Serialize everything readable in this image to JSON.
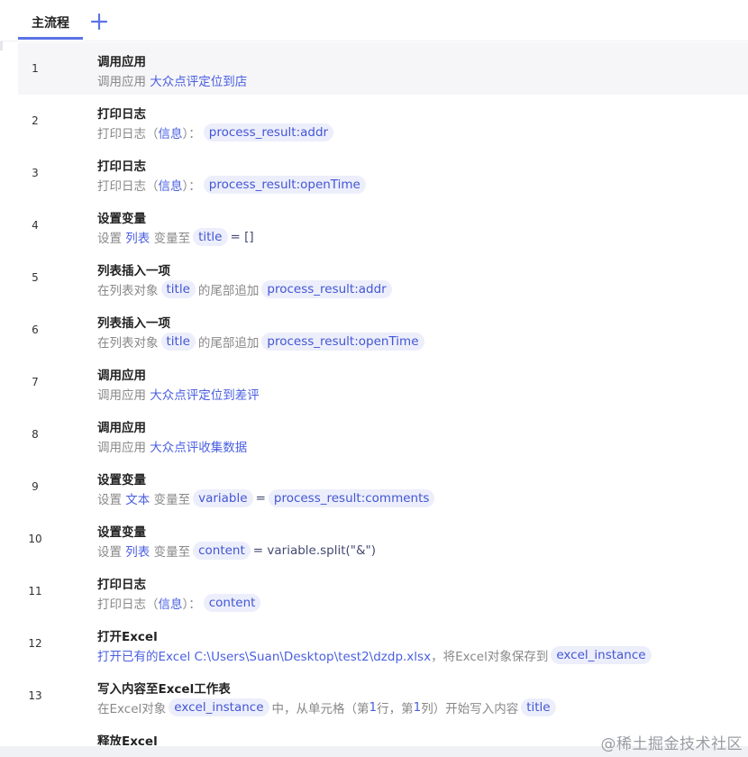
{
  "tabs": {
    "main_label": "主流程",
    "add_icon": "plus-icon"
  },
  "steps": [
    {
      "num": "1",
      "title": "调用应用",
      "selected": true,
      "segs": [
        {
          "t": "调用应用 ",
          "k": "t"
        },
        {
          "t": "大众点评定位到店",
          "k": "l"
        }
      ]
    },
    {
      "num": "2",
      "title": "打印日志",
      "segs": [
        {
          "t": "打印日志（",
          "k": "t"
        },
        {
          "t": "信息",
          "k": "l"
        },
        {
          "t": "）：",
          "k": "t"
        },
        {
          "t": "process_result:addr",
          "k": "p"
        }
      ]
    },
    {
      "num": "3",
      "title": "打印日志",
      "segs": [
        {
          "t": "打印日志（",
          "k": "t"
        },
        {
          "t": "信息",
          "k": "l"
        },
        {
          "t": "）：",
          "k": "t"
        },
        {
          "t": "process_result:openTime",
          "k": "p"
        }
      ]
    },
    {
      "num": "4",
      "title": "设置变量",
      "segs": [
        {
          "t": "设置 ",
          "k": "t"
        },
        {
          "t": "列表",
          "k": "l"
        },
        {
          "t": " 变量至",
          "k": "t"
        },
        {
          "t": "title",
          "k": "p"
        },
        {
          "t": "= []",
          "k": "c"
        }
      ]
    },
    {
      "num": "5",
      "title": "列表插入一项",
      "segs": [
        {
          "t": "在列表对象",
          "k": "t"
        },
        {
          "t": "title",
          "k": "p"
        },
        {
          "t": "的尾部追加",
          "k": "t"
        },
        {
          "t": "process_result:addr",
          "k": "p"
        }
      ]
    },
    {
      "num": "6",
      "title": "列表插入一项",
      "segs": [
        {
          "t": "在列表对象",
          "k": "t"
        },
        {
          "t": "title",
          "k": "p"
        },
        {
          "t": "的尾部追加",
          "k": "t"
        },
        {
          "t": "process_result:openTime",
          "k": "p"
        }
      ]
    },
    {
      "num": "7",
      "title": "调用应用",
      "segs": [
        {
          "t": "调用应用 ",
          "k": "t"
        },
        {
          "t": "大众点评定位到差评",
          "k": "l"
        }
      ]
    },
    {
      "num": "8",
      "title": "调用应用",
      "segs": [
        {
          "t": "调用应用 ",
          "k": "t"
        },
        {
          "t": "大众点评收集数据",
          "k": "l"
        }
      ]
    },
    {
      "num": "9",
      "title": "设置变量",
      "segs": [
        {
          "t": "设置 ",
          "k": "t"
        },
        {
          "t": "文本",
          "k": "l"
        },
        {
          "t": " 变量至",
          "k": "t"
        },
        {
          "t": "variable",
          "k": "p"
        },
        {
          "t": "=",
          "k": "c"
        },
        {
          "t": "process_result:comments",
          "k": "p"
        }
      ]
    },
    {
      "num": "10",
      "title": "设置变量",
      "segs": [
        {
          "t": "设置 ",
          "k": "t"
        },
        {
          "t": "列表",
          "k": "l"
        },
        {
          "t": " 变量至",
          "k": "t"
        },
        {
          "t": "content",
          "k": "p"
        },
        {
          "t": "= variable.split(\"&\")",
          "k": "c"
        }
      ]
    },
    {
      "num": "11",
      "title": "打印日志",
      "segs": [
        {
          "t": "打印日志（",
          "k": "t"
        },
        {
          "t": "信息",
          "k": "l"
        },
        {
          "t": "）：",
          "k": "t"
        },
        {
          "t": "content",
          "k": "p"
        }
      ]
    },
    {
      "num": "12",
      "title": "打开Excel",
      "segs": [
        {
          "t": "打开已有的Excel C:\\Users\\Suan\\Desktop\\test2\\dzdp.xlsx",
          "k": "l"
        },
        {
          "t": "，将Excel对象保存到",
          "k": "t"
        },
        {
          "t": "excel_instance",
          "k": "p"
        }
      ]
    },
    {
      "num": "13",
      "title": "写入内容至Excel工作表",
      "segs": [
        {
          "t": "在Excel对象",
          "k": "t"
        },
        {
          "t": "excel_instance",
          "k": "p"
        },
        {
          "t": "中，从单元格（第",
          "k": "t"
        },
        {
          "t": "1",
          "k": "l"
        },
        {
          "t": "行，第",
          "k": "t"
        },
        {
          "t": "1",
          "k": "l"
        },
        {
          "t": "列）开始写入内容",
          "k": "t"
        },
        {
          "t": "title",
          "k": "p"
        }
      ]
    },
    {
      "num": "",
      "title": "释放Excel",
      "segs": []
    }
  ],
  "watermark": "@稀土掘金技术社区"
}
